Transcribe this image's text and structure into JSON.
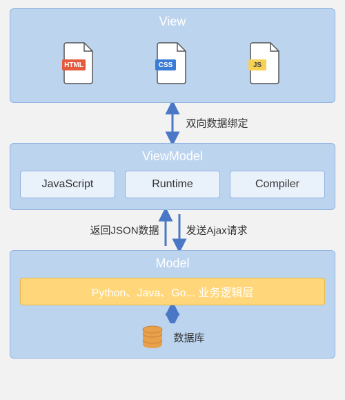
{
  "view": {
    "title": "View",
    "icons": {
      "html": "HTML",
      "css": "CSS",
      "js": "JS"
    }
  },
  "connector1": {
    "label": "双向数据绑定"
  },
  "viewmodel": {
    "title": "ViewModel",
    "items": [
      "JavaScript",
      "Runtime",
      "Compiler"
    ]
  },
  "connector2": {
    "up_label": "返回JSON数据",
    "down_label": "发送Ajax请求"
  },
  "model": {
    "title": "Model",
    "business": "Python、Java、Go... 业务逻辑层",
    "database": "数据库"
  },
  "colors": {
    "layer_bg": "#bdd4ef",
    "layer_border": "#8fb3e0",
    "box_bg": "#e9f1fb",
    "biz_bg": "#ffd77a",
    "arrow": "#4a78c7",
    "html": "#e55a3c",
    "css": "#3a7bd5",
    "js": "#f7d154",
    "db": "#e8a04a"
  }
}
